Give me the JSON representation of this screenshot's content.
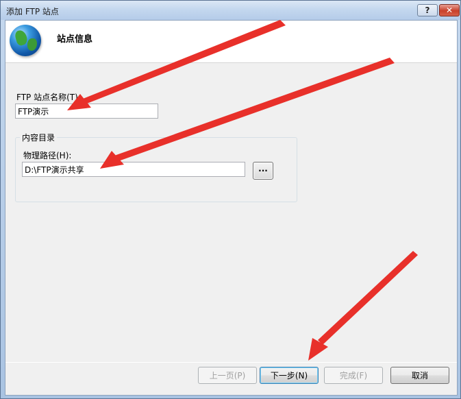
{
  "window": {
    "title": "添加 FTP 站点",
    "help_label": "?",
    "close_label": "✕"
  },
  "header": {
    "title": "站点信息",
    "icon": "globe-icon"
  },
  "form": {
    "site_name_label": "FTP 站点名称(T):",
    "site_name_value": "FTP演示",
    "content_group_title": "内容目录",
    "physical_path_label": "物理路径(H):",
    "physical_path_value": "D:\\FTP演示共享",
    "browse_label": "..."
  },
  "buttons": {
    "prev_label": "上一页(P)",
    "next_label": "下一步(N)",
    "finish_label": "完成(F)",
    "cancel_label": "取消"
  },
  "annotation": {
    "arrow_color": "#e8302a"
  }
}
